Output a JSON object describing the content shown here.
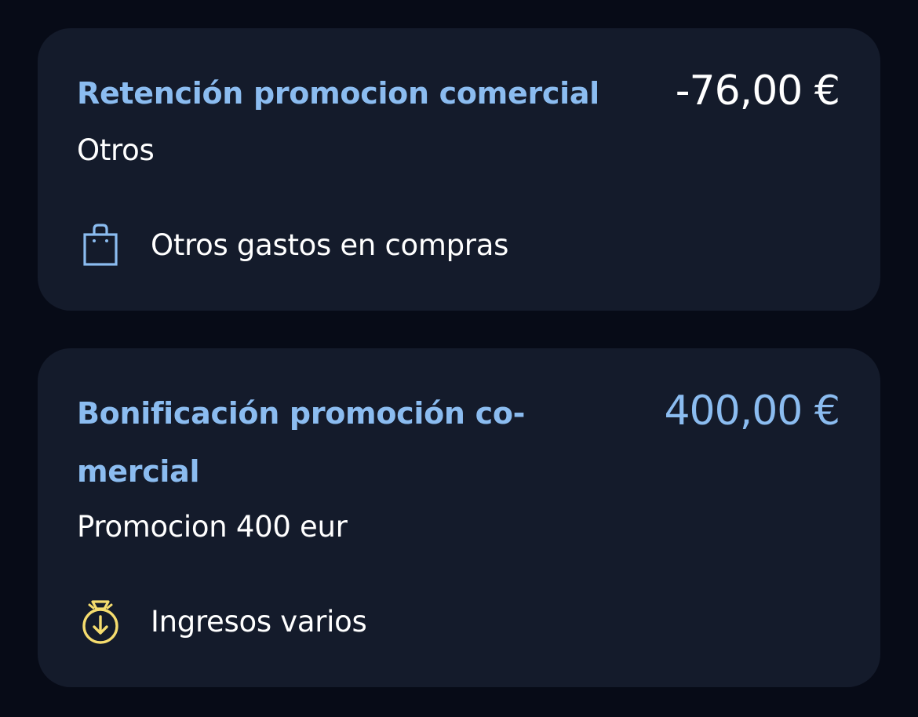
{
  "transactions": [
    {
      "title": "Retención promocion comercial",
      "subtitle": "Otros",
      "amount": "-76,00 €",
      "amount_color": "#ffffff",
      "category": "Otros gastos en compras",
      "category_icon": "shopping-bag-icon",
      "category_icon_color": "#8bbcf0"
    },
    {
      "title": "Bonificación promoción co-mercial",
      "subtitle": "Promocion 400 eur",
      "amount": "400,00 €",
      "amount_color": "#8bbcf0",
      "category": "Ingresos varios",
      "category_icon": "money-bag-income-icon",
      "category_icon_color": "#f5dc6e"
    }
  ],
  "colors": {
    "background": "#070b17",
    "card": "#141b2b",
    "accent": "#8bbcf0",
    "text": "#ffffff"
  }
}
